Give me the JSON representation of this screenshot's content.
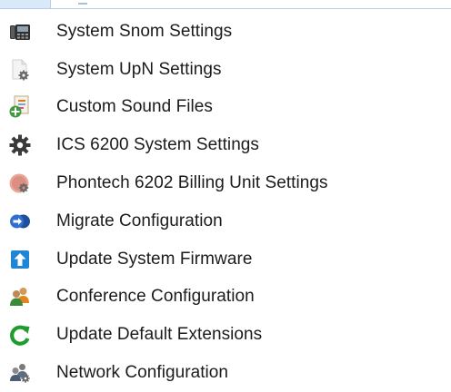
{
  "menu": {
    "items": [
      {
        "label": "System Snom Settings",
        "icon": "desk-phone-icon"
      },
      {
        "label": "System UpN Settings",
        "icon": "document-gear-icon"
      },
      {
        "label": "Custom Sound Files",
        "icon": "sound-file-add-icon"
      },
      {
        "label": "ICS 6200 System Settings",
        "icon": "gear-icon"
      },
      {
        "label": "Phontech 6202 Billing Unit Settings",
        "icon": "billing-gear-icon"
      },
      {
        "label": "Migrate Configuration",
        "icon": "migrate-arrow-icon"
      },
      {
        "label": "Update System Firmware",
        "icon": "upload-arrow-icon"
      },
      {
        "label": "Conference Configuration",
        "icon": "people-icon"
      },
      {
        "label": "Update Default Extensions",
        "icon": "refresh-arrow-icon"
      },
      {
        "label": "Network Configuration",
        "icon": "network-people-icon"
      }
    ]
  }
}
